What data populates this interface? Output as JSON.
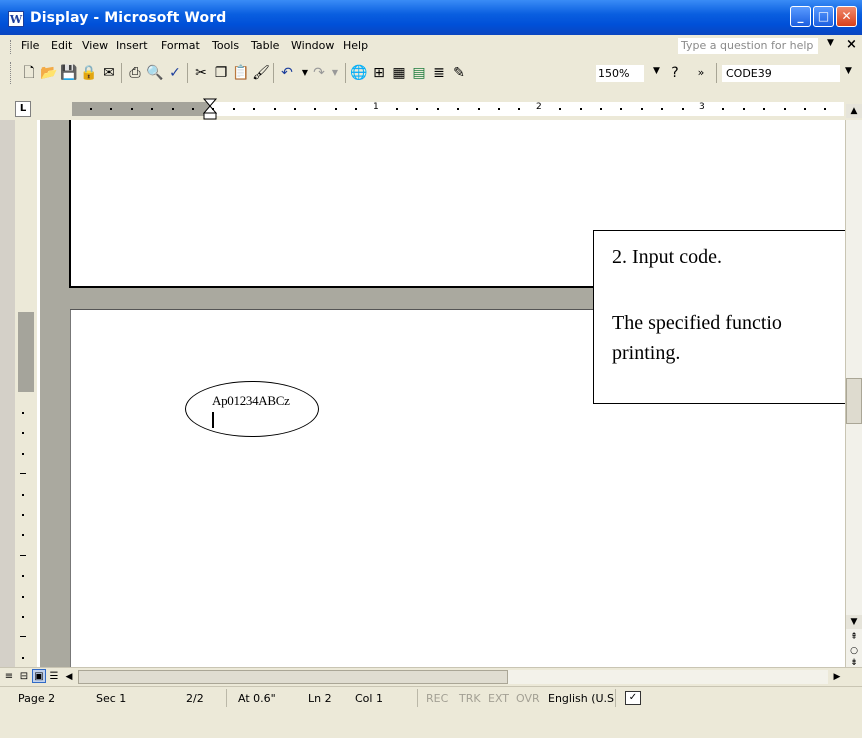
{
  "window": {
    "title": "Display - Microsoft Word",
    "controls": {
      "minimize": "_",
      "maximize": "□",
      "close": "✕"
    }
  },
  "menu": {
    "items": [
      "File",
      "Edit",
      "View",
      "Insert",
      "Format",
      "Tools",
      "Table",
      "Window",
      "Help"
    ],
    "ask_placeholder": "Type a question for help",
    "close_doc": "×"
  },
  "toolbar": {
    "zoom": "150%",
    "font_name": "CODE39",
    "chevron": "»",
    "icons": [
      "new-icon",
      "open-icon",
      "save-icon",
      "permission-icon",
      "email-icon",
      "print-icon",
      "print-preview-icon",
      "spelling-icon",
      "cut-icon",
      "copy-icon",
      "paste-icon",
      "format-painter-icon",
      "undo-icon",
      "redo-icon",
      "hyperlink-icon",
      "tables-borders-icon",
      "insert-table-icon",
      "insert-excel-icon",
      "columns-icon",
      "drawing-icon",
      "help-icon"
    ]
  },
  "ruler": {
    "tab_selector": "L",
    "numbers": [
      "1",
      "2",
      "3"
    ]
  },
  "document": {
    "code_text": "Ap01234ABCz"
  },
  "callout": {
    "line1": "2. Input code.",
    "line2": "The specified functio",
    "line3": "printing."
  },
  "statusbar": {
    "page": "Page 2",
    "section": "Sec 1",
    "pages": "2/2",
    "at": "At 0.6\"",
    "line": "Ln 2",
    "col": "Col 1",
    "rec": "REC",
    "trk": "TRK",
    "ext": "EXT",
    "ovr": "OVR",
    "language": "English (U.S"
  }
}
